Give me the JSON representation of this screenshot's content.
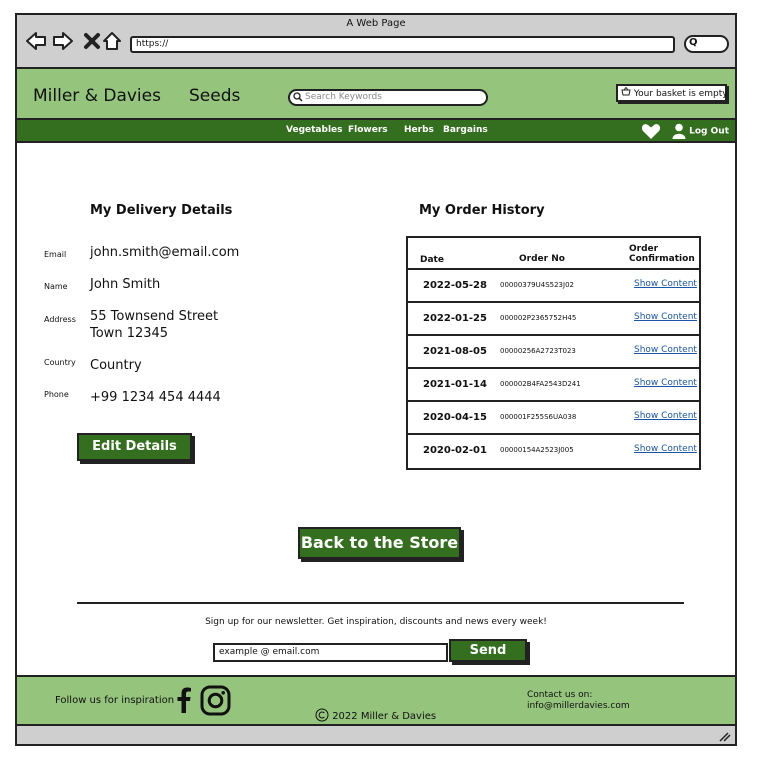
{
  "browser": {
    "title": "A Web Page",
    "url": "https://",
    "search_glyph": "Q"
  },
  "header": {
    "brand": "Miller & Davies",
    "section": "Seeds",
    "search_placeholder": "Search Keywords",
    "basket": "Your basket is empty"
  },
  "nav": {
    "items": [
      "Vegetables",
      "Flowers",
      "Herbs",
      "Bargains"
    ],
    "logout": "Log Out"
  },
  "delivery": {
    "title": "My Delivery Details",
    "fields": [
      {
        "label": "Email",
        "value": "john.smith@email.com"
      },
      {
        "label": "Name",
        "value": "John Smith"
      },
      {
        "label": "Address",
        "value": "55 Townsend Street",
        "value2": "Town 12345"
      },
      {
        "label": "Country",
        "value": "Country"
      },
      {
        "label": "Phone",
        "value": "+99 1234 454 4444"
      }
    ],
    "edit_button": "Edit Details"
  },
  "orders": {
    "title": "My Order History",
    "headers": {
      "date": "Date",
      "order_no": "Order No",
      "confirmation_1": "Order",
      "confirmation_2": "Confirmation"
    },
    "rows": [
      {
        "date": "2022-05-28",
        "order_no": "00000379U4S523J02",
        "link": "Show Content"
      },
      {
        "date": "2022-01-25",
        "order_no": "000002P2365752H45",
        "link": "Show Content"
      },
      {
        "date": "2021-08-05",
        "order_no": "00000256A2723T023",
        "link": "Show Content"
      },
      {
        "date": "2021-01-14",
        "order_no": "000002B4FA2543D241",
        "link": "Show Content"
      },
      {
        "date": "2020-04-15",
        "order_no": "000001F255S6UA038",
        "link": "Show Content"
      },
      {
        "date": "2020-02-01",
        "order_no": "00000154A2523J005",
        "link": "Show Content"
      }
    ]
  },
  "back_button": "Back to the Store",
  "newsletter": {
    "text": "Sign up for our newsletter. Get inspiration, discounts and news every week!",
    "email_value": "example @ email.com",
    "send": "Send"
  },
  "footer": {
    "follow": "Follow us for inspiration",
    "copyright": "2022 Miller & Davies",
    "contact_label": "Contact us on:",
    "contact_email": "info@millerdavies.com"
  },
  "colors": {
    "header_green": "#95c47d",
    "nav_green": "#336f1f",
    "chrome_gray": "#cfcfcf",
    "link_blue": "#1a56a6"
  },
  "icons": [
    "back-arrow-icon",
    "forward-arrow-icon",
    "close-icon",
    "home-icon",
    "search-icon",
    "basket-icon",
    "heart-icon",
    "user-icon",
    "facebook-icon",
    "instagram-icon",
    "copyright-icon",
    "resize-grip-icon"
  ]
}
